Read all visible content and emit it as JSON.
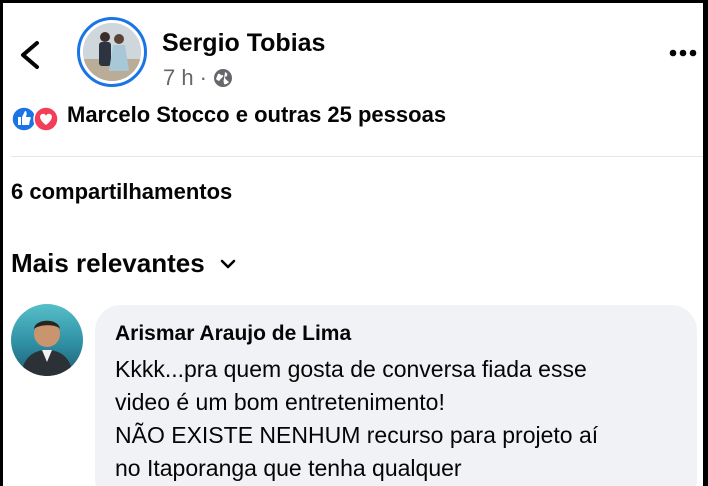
{
  "post": {
    "author_name": "Sergio Tobias",
    "time": "7 h",
    "separator": "·",
    "privacy_icon": "globe-icon"
  },
  "reactions": {
    "icons": [
      "like-icon",
      "love-icon"
    ],
    "text": "Marcelo Stocco e outras 25 pessoas"
  },
  "shares_text": "6 compartilhamentos",
  "sort": {
    "label": "Mais relevantes",
    "icon": "chevron-down-icon"
  },
  "comments": [
    {
      "author": "Arismar Araujo de Lima",
      "lines": [
        "Kkkk...pra quem gosta de conversa fiada esse",
        "video é um bom entretenimento!",
        "NÃO EXISTE NENHUM recurso para projeto aí",
        "no Itaporanga que tenha qualquer"
      ]
    }
  ],
  "colors": {
    "brand_blue": "#1b74e4",
    "love_red": "#f33e58",
    "secondary_text": "#65676b",
    "bubble_bg": "#f0f2f5"
  }
}
